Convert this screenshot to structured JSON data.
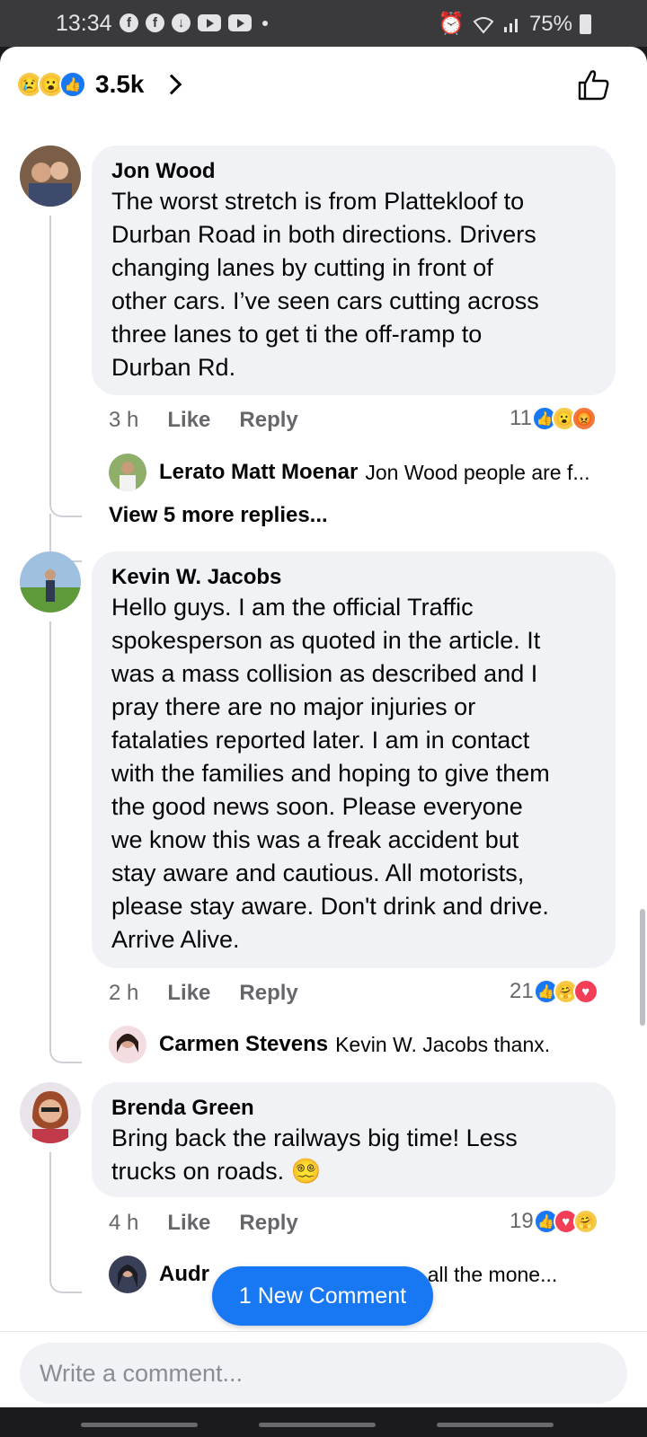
{
  "status_bar": {
    "time": "13:34",
    "battery": "75%"
  },
  "header": {
    "reaction_count": "3.5k"
  },
  "comments": [
    {
      "author": "Jon Wood",
      "lines": [
        "The worst stretch is from Plattekloof  to",
        "Durban Road in both directions. Drivers",
        "changing lanes by cutting in front of",
        "other cars. I’ve seen cars cutting across",
        "three lanes to get ti the off-ramp to",
        "Durban Rd."
      ],
      "time": "3 h",
      "like": "Like",
      "reply": "Reply",
      "reactions": "11",
      "replies": [
        {
          "author": "Lerato Matt Moenar",
          "text": "Jon Wood people are f..."
        }
      ],
      "view_more": "View 5 more replies..."
    },
    {
      "author": "Kevin W. Jacobs",
      "lines": [
        "Hello guys. I am the official Traffic",
        "spokesperson as quoted in the article. It",
        "was a mass collision as described and I",
        "pray there are no major injuries or",
        "fatalaties reported later. I am in contact",
        "with the families and hoping to give them",
        "the good news soon. Please everyone",
        "we know this was a freak accident but",
        "stay aware and cautious. All motorists,",
        "please stay aware. Don't drink and drive.",
        "Arrive Alive."
      ],
      "time": "2 h",
      "like": "Like",
      "reply": "Reply",
      "reactions": "21",
      "replies": [
        {
          "author": "Carmen Stevens",
          "text": "Kevin W. Jacobs thanx."
        }
      ]
    },
    {
      "author": "Brenda Green",
      "lines": [
        "Bring back the railways big  time! Less",
        "trucks on roads.  😵‍💫"
      ],
      "time": "4 h",
      "like": "Like",
      "reply": "Reply",
      "reactions": "19",
      "replies": [
        {
          "author": "Audr",
          "text": "een all the mone..."
        }
      ]
    }
  ],
  "new_comment_label": "1 New Comment",
  "compose": {
    "placeholder": "Write a comment..."
  },
  "colors": {
    "accent": "#1877f2",
    "bubble": "#f0f2f5",
    "text": "#050505",
    "muted": "#65676b"
  }
}
